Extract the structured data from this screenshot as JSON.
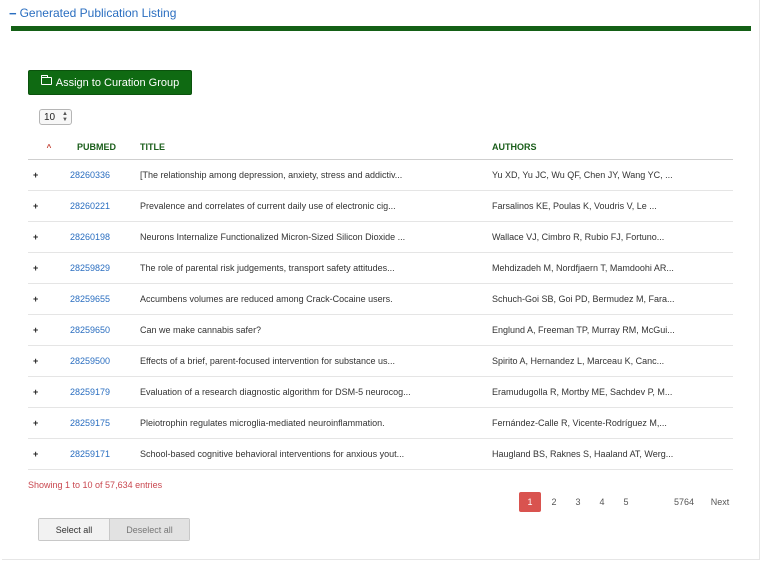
{
  "section": {
    "collapse_glyph": "−",
    "title": "Generated Publication Listing"
  },
  "toolbar": {
    "assign_label": "Assign to Curation Group",
    "assign_icon": "folder-icon"
  },
  "page_length": {
    "value": "10",
    "spin_up": "▲",
    "spin_down": "▼"
  },
  "table": {
    "sort_indicator": "^",
    "headers": {
      "pubmed": "PUBMED",
      "title": "TITLE",
      "authors": "AUTHORS"
    },
    "expand_glyph": "+",
    "rows": [
      {
        "pmid": "28260336",
        "title": "[The relationship among depression, anxiety, stress and addictiv...",
        "authors": "Yu XD, Yu JC, Wu QF, Chen JY, Wang YC, ..."
      },
      {
        "pmid": "28260221",
        "title": "Prevalence and correlates of current daily use of electronic cig...",
        "authors": "Farsalinos KE, Poulas K, Voudris V, Le ..."
      },
      {
        "pmid": "28260198",
        "title": "Neurons Internalize Functionalized Micron-Sized Silicon Dioxide ...",
        "authors": "Wallace VJ, Cimbro R, Rubio FJ, Fortuno..."
      },
      {
        "pmid": "28259829",
        "title": "The role of parental risk judgements, transport safety attitudes...",
        "authors": "Mehdizadeh M, Nordfjaern T, Mamdoohi AR..."
      },
      {
        "pmid": "28259655",
        "title": "Accumbens volumes are reduced among Crack-Cocaine users.",
        "authors": "Schuch-Goi SB, Goi PD, Bermudez M, Fara..."
      },
      {
        "pmid": "28259650",
        "title": "Can we make cannabis safer?",
        "authors": "Englund A, Freeman TP, Murray RM, McGui..."
      },
      {
        "pmid": "28259500",
        "title": "Effects of a brief, parent-focused intervention for substance us...",
        "authors": "Spirito A, Hernandez L, Marceau K, Canc..."
      },
      {
        "pmid": "28259179",
        "title": "Evaluation of a research diagnostic algorithm for DSM-5 neurocog...",
        "authors": "Eramudugolla R, Mortby ME, Sachdev P, M..."
      },
      {
        "pmid": "28259175",
        "title": "Pleiotrophin regulates microglia-mediated neuroinflammation.",
        "authors": "Fernández-Calle R, Vicente-Rodríguez M,..."
      },
      {
        "pmid": "28259171",
        "title": "School-based cognitive behavioral interventions for anxious yout...",
        "authors": "Haugland BS, Raknes S, Haaland AT, Werg..."
      }
    ]
  },
  "info_text": "Showing 1 to 10 of 57,634 entries",
  "pagination": {
    "pages": [
      "1",
      "2",
      "3",
      "4",
      "5"
    ],
    "last": "5764",
    "next": "Next",
    "active": "1"
  },
  "selection": {
    "select_all": "Select all",
    "deselect_all": "Deselect all"
  },
  "colors": {
    "accent_blue": "#2a6ec0",
    "brand_green": "#146016",
    "button_green": "#0f6a12",
    "header_green": "#1a5d1a",
    "active_page": "#d9534f",
    "info_red": "#c9474f"
  }
}
